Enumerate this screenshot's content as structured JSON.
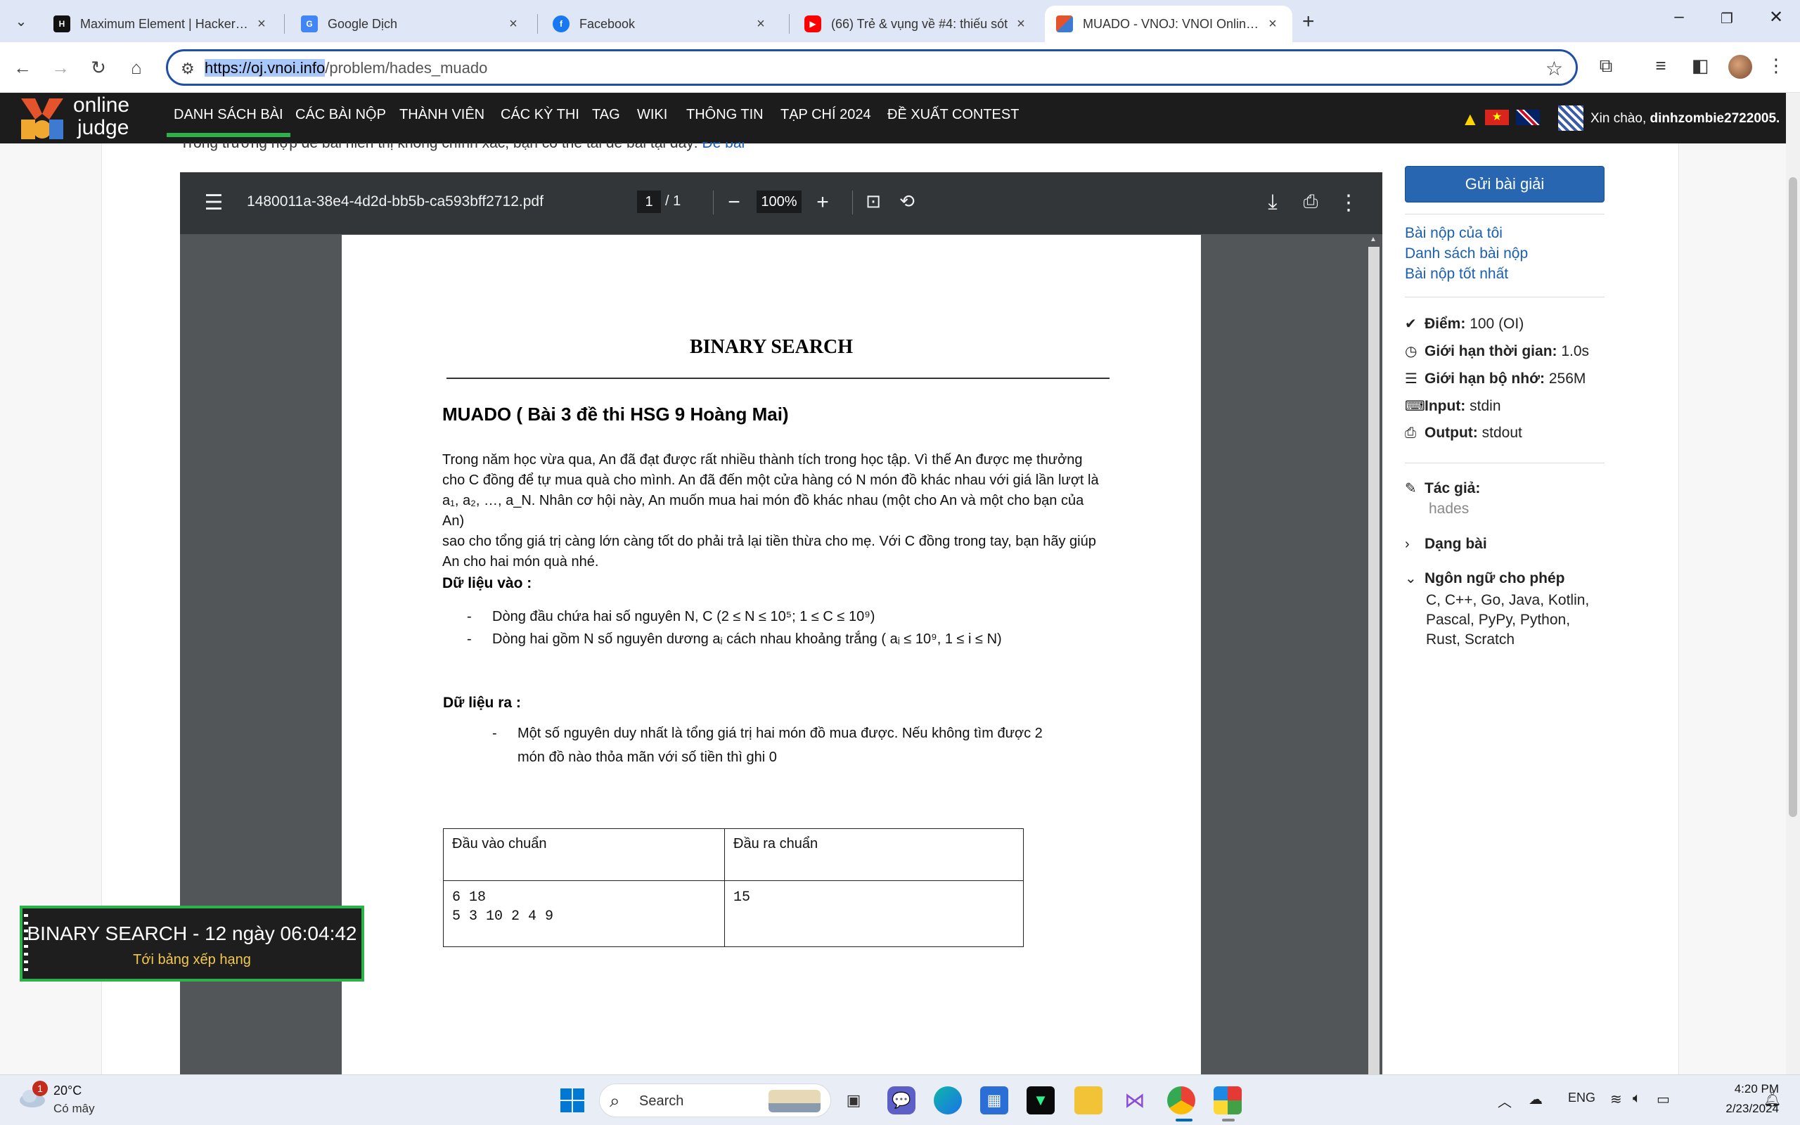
{
  "browser": {
    "tabs": [
      {
        "title": "Maximum Element | HackerRank",
        "favicon": "hackerrank-icon",
        "color": "#111111"
      },
      {
        "title": "Google Dịch",
        "favicon": "google-translate-icon",
        "color": "#4285f4"
      },
      {
        "title": "Facebook",
        "favicon": "facebook-icon",
        "color": "#1877f2"
      },
      {
        "title": "(66) Trẻ & vụng về #4: thiếu sót",
        "favicon": "youtube-icon",
        "color": "#ff0000"
      },
      {
        "title": "MUADO - VNOJ: VNOI Online Judge",
        "favicon": "vnoj-icon",
        "color": "#e5532d",
        "active": true
      }
    ],
    "url_host": "https://oj.vnoi.info",
    "url_path": "/problem/hades_muado"
  },
  "site": {
    "logo_line1": "online",
    "logo_line2": "judge",
    "nav": [
      "DANH SÁCH BÀI",
      "CÁC BÀI NỘP",
      "THÀNH VIÊN",
      "CÁC KỲ THI",
      "TAG",
      "WIKI",
      "THÔNG TIN",
      "TẠP CHÍ 2024",
      "ĐỀ XUẤT CONTEST"
    ],
    "greeting_prefix": "Xin chào, ",
    "username": "dinhzombie2722005."
  },
  "notice": {
    "text": "Trong trường hợp đề bài hiển thị không chính xác, bạn có thể tải đề bài tại đây: ",
    "link": "Đề bài"
  },
  "pdf": {
    "filename": "1480011a-38e4-4d2d-bb5b-ca593bff2712.pdf",
    "page_current": "1",
    "page_total": "/  1",
    "zoom": "100%"
  },
  "doc": {
    "title": "BINARY SEARCH",
    "problem_heading": "MUADO ( Bài 3 đề thi HSG 9 Hoàng Mai)",
    "statement_lines": [
      "Trong năm học vừa qua, An đã đạt được rất nhiều thành tích trong học tập. Vì thế An được mẹ thưởng",
      "cho C đồng để tự mua quà cho mình. An đã đến một cửa hàng có N món đồ khác nhau với giá lần lượt là",
      "a₁, a₂, …, a_N. Nhân cơ hội này, An muốn mua hai món đồ khác nhau (một cho An và một cho bạn của An)",
      "sao cho tổng giá trị càng lớn càng tốt do phải trả lại tiền thừa cho mẹ. Với C đồng trong tay, bạn hãy giúp",
      "An cho hai món quà nhé."
    ],
    "input_heading": "Dữ liệu vào :",
    "input_items": [
      "Dòng đầu chứa hai số nguyên N, C (2 ≤ N ≤ 10⁵; 1 ≤ C ≤ 10⁹)",
      "Dòng hai gồm N số nguyên dương aᵢ cách nhau khoảng trắng ( aᵢ ≤ 10⁹, 1 ≤ i ≤ N)"
    ],
    "output_heading": "Dữ liệu ra :",
    "output_line1": "Một số nguyên duy nhất là tổng giá trị hai món đồ mua được. Nếu không tìm được 2",
    "output_line2": "món đồ nào thỏa mãn với số tiền thì ghi 0",
    "table_header_in": "Đầu vào chuẩn",
    "table_header_out": "Đầu ra chuẩn",
    "sample_in": "6 18\n5 3 10 2 4 9",
    "sample_out": "15"
  },
  "sidebar": {
    "submit": "Gửi bài giải",
    "links": [
      "Bài nộp của tôi",
      "Danh sách bài nộp",
      "Bài nộp tốt nhất"
    ],
    "points_label": "Điểm:",
    "points_value": " 100 (OI)",
    "time_label": "Giới hạn thời gian:",
    "time_value": " 1.0s",
    "memory_label": "Giới hạn bộ nhớ:",
    "memory_value": " 256M",
    "input_label": "Input:",
    "input_value": " stdin",
    "output_label": "Output:",
    "output_value": " stdout",
    "author_label": "Tác giả:",
    "author_value": "hades",
    "type_label": "Dạng bài",
    "lang_label": "Ngôn ngữ cho phép",
    "lang_value": "C, C++, Go, Java, Kotlin, Pascal, PyPy, Python, Rust, Scratch"
  },
  "timer": {
    "line1": "BINARY SEARCH - 12 ngày 06:04:42",
    "line2": "Tới bảng xếp hạng"
  },
  "taskbar": {
    "badge": "1",
    "temp": "20°C",
    "weather": "Có mây",
    "search": "Search",
    "lang": "ENG",
    "time": "4:20 PM",
    "date": "2/23/2024"
  },
  "colors": {
    "accent_green": "#2bb34a",
    "header_bg": "#1c1c1c",
    "link_blue": "#1a5fb4",
    "submit_blue": "#2966b2"
  }
}
